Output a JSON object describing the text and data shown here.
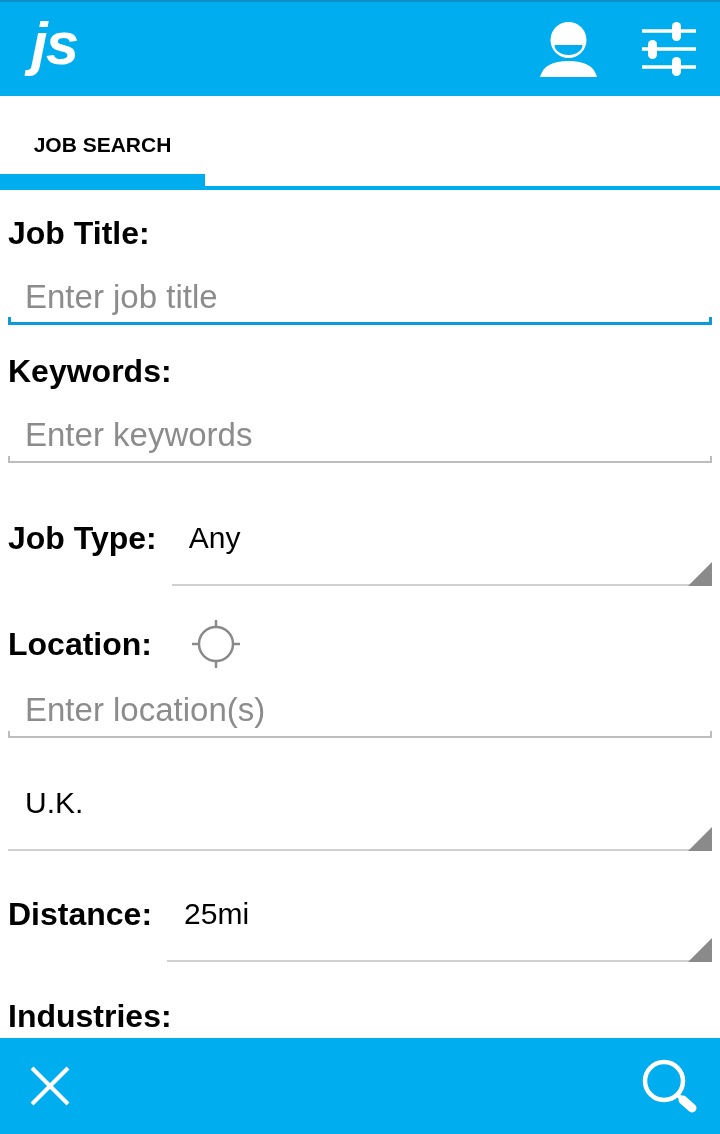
{
  "app_bar": {
    "logo": "js"
  },
  "tabs": [
    {
      "label": "JOB SEARCH",
      "selected": true
    }
  ],
  "form": [
    {
      "kind": "text",
      "label": "Job Title:",
      "placeholder": "Enter job title",
      "focused": true
    },
    {
      "kind": "text",
      "label": "Keywords:",
      "placeholder": "Enter keywords",
      "focused": false
    },
    {
      "kind": "select",
      "label": "Job Type:",
      "value": "Any"
    },
    {
      "kind": "location",
      "label": "Location:",
      "placeholder": "Enter location(s)",
      "focused": false
    },
    {
      "kind": "select",
      "value": "U.K."
    },
    {
      "kind": "select",
      "label": "Distance:",
      "value": "25mi"
    },
    {
      "kind": "heading",
      "label": "Industries:"
    }
  ]
}
